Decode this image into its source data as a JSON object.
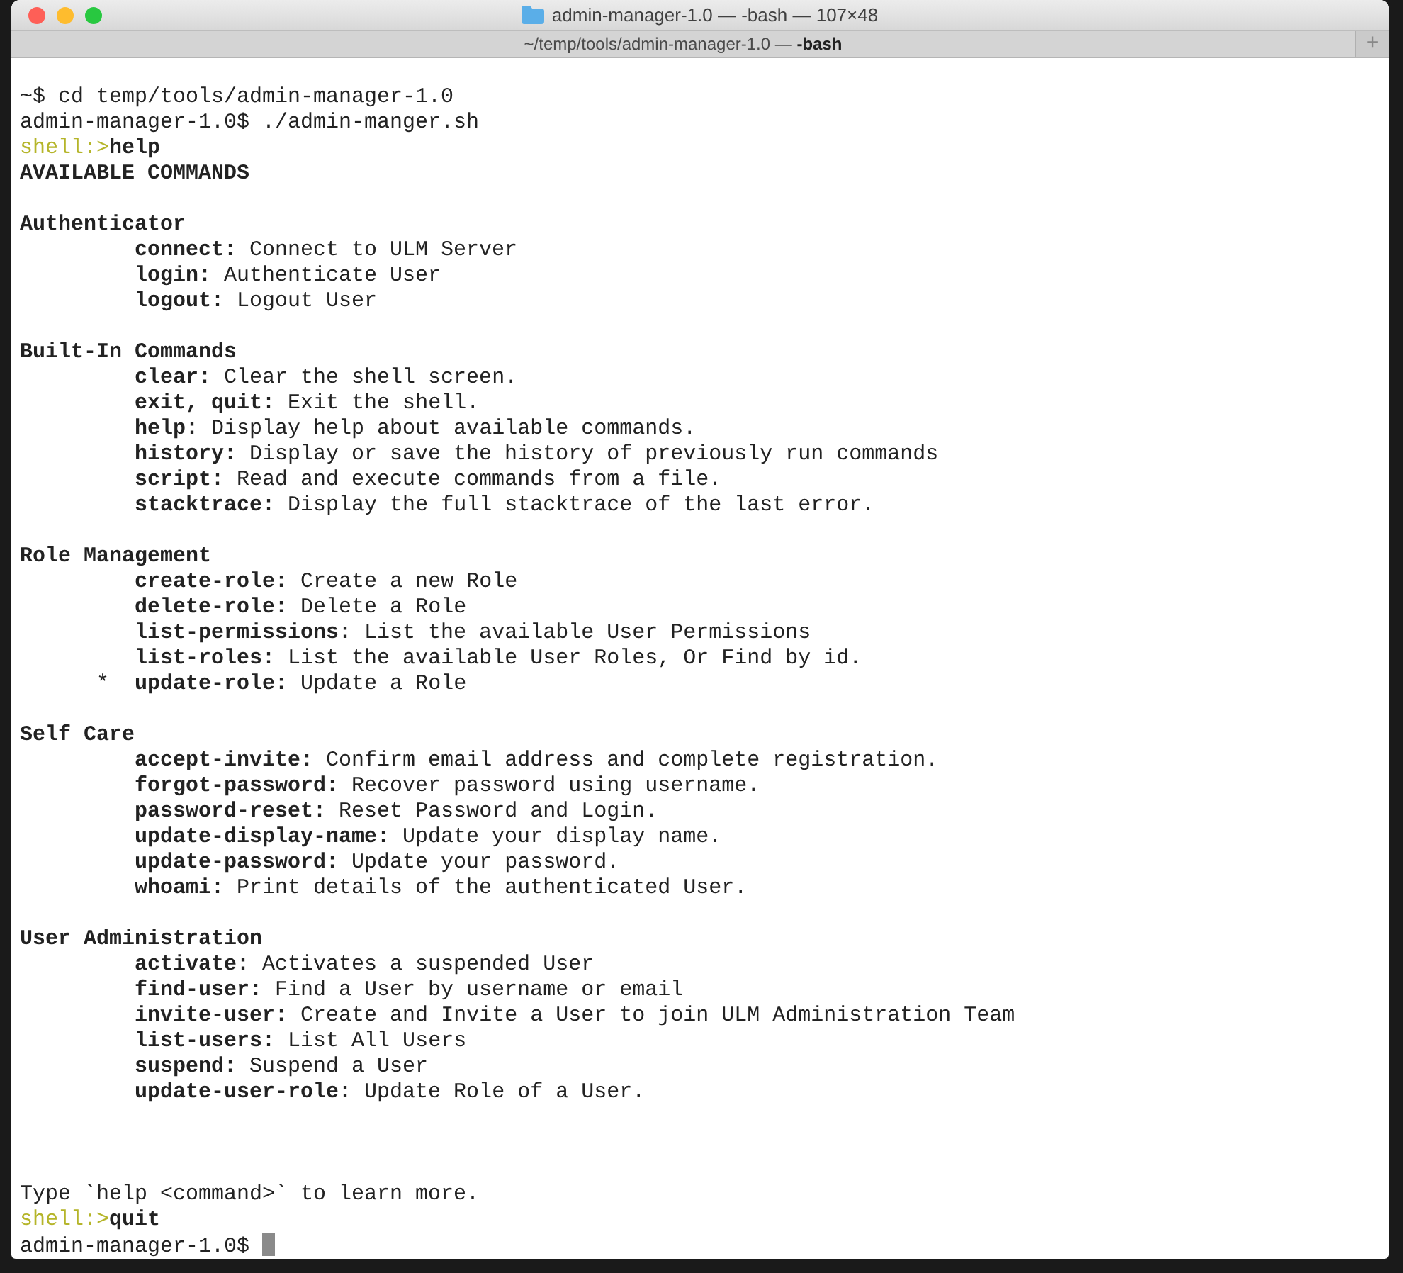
{
  "window": {
    "title": "admin-manager-1.0 — -bash — 107×48"
  },
  "tab": {
    "label": "~/temp/tools/admin-manager-1.0 — **-bash**"
  },
  "new_tab_button": "+",
  "terminal": {
    "intro": [
      {
        "kind": "plain",
        "text": "~$ cd temp/tools/admin-manager-1.0"
      },
      {
        "kind": "plain",
        "text": "admin-manager-1.0$ ./admin-manger.sh"
      },
      {
        "kind": "prompt",
        "prompt": "shell:>",
        "input": "help"
      },
      {
        "kind": "heading",
        "text": "AVAILABLE COMMANDS"
      }
    ],
    "sections": [
      {
        "title": "Authenticator",
        "commands": [
          {
            "name": "connect:",
            "description": "Connect to ULM Server"
          },
          {
            "name": "login:",
            "description": "Authenticate User"
          },
          {
            "name": "logout:",
            "description": "Logout User"
          }
        ]
      },
      {
        "title": "Built-In Commands",
        "commands": [
          {
            "name": "clear:",
            "description": "Clear the shell screen."
          },
          {
            "name": "exit, quit:",
            "description": "Exit the shell."
          },
          {
            "name": "help:",
            "description": "Display help about available commands."
          },
          {
            "name": "history:",
            "description": "Display or save the history of previously run commands"
          },
          {
            "name": "script:",
            "description": "Read and execute commands from a file."
          },
          {
            "name": "stacktrace:",
            "description": "Display the full stacktrace of the last error."
          }
        ]
      },
      {
        "title": "Role Management",
        "commands": [
          {
            "name": "create-role:",
            "description": "Create a new Role"
          },
          {
            "name": "delete-role:",
            "description": "Delete a Role"
          },
          {
            "name": "list-permissions:",
            "description": "List the available User Permissions"
          },
          {
            "name": "list-roles:",
            "description": "List the available User Roles, Or Find by id."
          },
          {
            "marker": "*",
            "name": "update-role:",
            "description": "Update a Role"
          }
        ]
      },
      {
        "title": "Self Care",
        "commands": [
          {
            "name": "accept-invite:",
            "description": "Confirm email address and complete registration."
          },
          {
            "name": "forgot-password:",
            "description": "Recover password using username."
          },
          {
            "name": "password-reset:",
            "description": "Reset Password and Login."
          },
          {
            "name": "update-display-name:",
            "description": "Update your display name."
          },
          {
            "name": "update-password:",
            "description": "Update your password."
          },
          {
            "name": "whoami:",
            "description": "Print details of the authenticated User."
          }
        ]
      },
      {
        "title": "User Administration",
        "commands": [
          {
            "name": "activate:",
            "description": "Activates a suspended User"
          },
          {
            "name": "find-user:",
            "description": "Find a User by username or email"
          },
          {
            "name": "invite-user:",
            "description": "Create and Invite a User to join ULM Administration Team"
          },
          {
            "name": "list-users:",
            "description": "List All Users"
          },
          {
            "name": "suspend:",
            "description": "Suspend a User"
          },
          {
            "name": "update-user-role:",
            "description": "Update Role of a User."
          }
        ]
      }
    ],
    "footer": [
      {
        "kind": "plain",
        "text": "Type `help <command>` to learn more."
      },
      {
        "kind": "prompt",
        "prompt": "shell:>",
        "input": "quit"
      },
      {
        "kind": "cursor",
        "text": "admin-manager-1.0$"
      }
    ]
  }
}
